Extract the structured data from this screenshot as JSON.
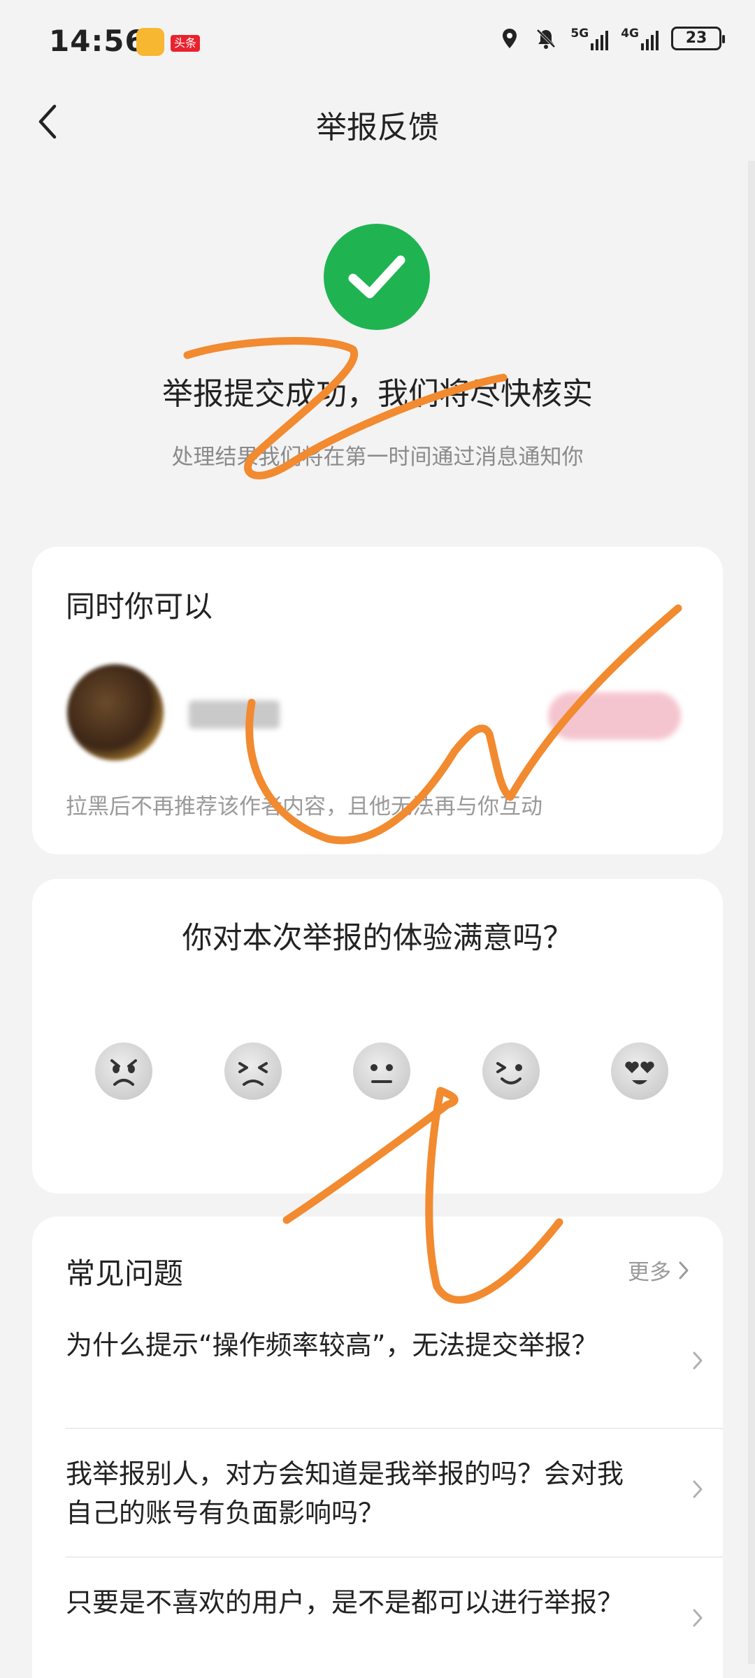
{
  "status_bar": {
    "time": "14:56",
    "toutiao_label": "头条",
    "battery": "23",
    "signal1": "5G",
    "signal2": "4G"
  },
  "nav": {
    "title": "举报反馈"
  },
  "result": {
    "title": "举报提交成功，我们将尽快核实",
    "subtitle": "处理结果我们将在第一时间通过消息通知你",
    "icon_color": "#1fb451"
  },
  "actions_card": {
    "heading": "同时你可以",
    "block_description": "拉黑后不再推荐该作者内容，且他无法再与你互动"
  },
  "survey": {
    "question": "你对本次举报的体验满意吗？",
    "faces": [
      "angry-face-icon",
      "frustrated-face-icon",
      "neutral-face-icon",
      "smiling-face-icon",
      "heart-eyes-face-icon"
    ]
  },
  "faq": {
    "title": "常见问题",
    "more": "更多",
    "items": [
      "为什么提示“操作频率较高”，无法提交举报？",
      "我举报别人，对方会知道是我举报的吗？会对我自己的账号有负面影响吗？",
      "只要是不喜欢的用户，是不是都可以进行举报？"
    ]
  }
}
